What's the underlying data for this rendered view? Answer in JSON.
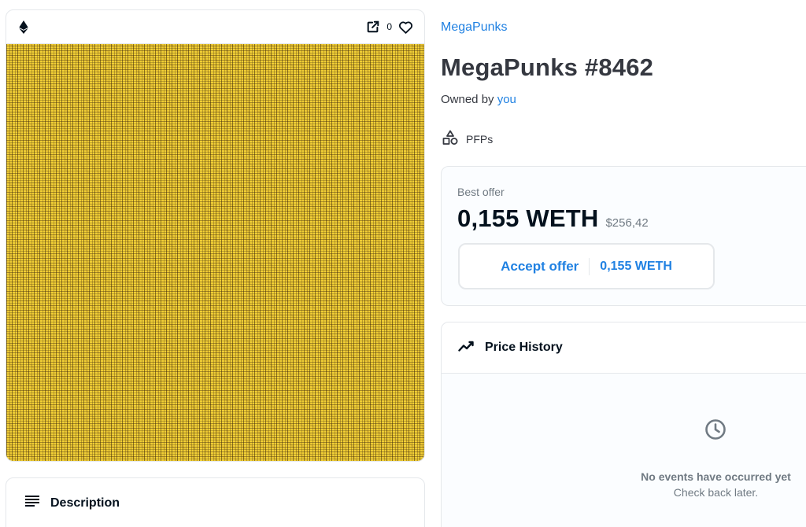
{
  "media": {
    "chain_icon": "ethereum-icon",
    "open_icon": "external-link-icon",
    "favorite_count": "0",
    "favorite_icon": "heart-icon",
    "artwork_colors": {
      "base": "#f1cf36",
      "detail": "#3c280a"
    }
  },
  "description": {
    "icon": "list-icon",
    "title": "Description"
  },
  "item": {
    "collection": "MegaPunks",
    "title": "MegaPunks #8462",
    "owned_by_prefix": "Owned by",
    "owner": "you",
    "category_icon": "shapes-icon",
    "category": "PFPs"
  },
  "offer": {
    "label": "Best offer",
    "value": "0,155 WETH",
    "fiat": "$256,42",
    "button_label": "Accept offer",
    "button_amount": "0,155 WETH"
  },
  "price_history": {
    "icon": "trend-icon",
    "title": "Price History",
    "empty_icon": "clock-icon",
    "empty_title": "No events have occurred yet",
    "empty_subtitle": "Check back later."
  },
  "colors": {
    "accent": "#2081e2",
    "text": "#353840",
    "muted": "#707a83",
    "border": "#e5e8eb"
  }
}
